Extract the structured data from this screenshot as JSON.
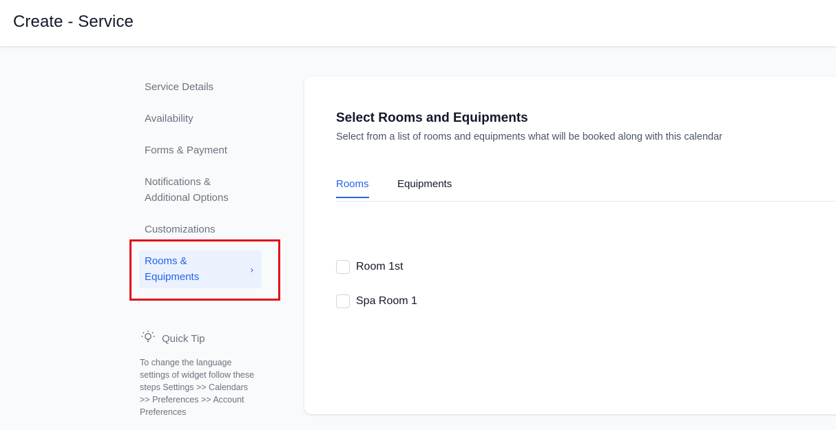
{
  "header": {
    "title": "Create - Service"
  },
  "sidebar": {
    "items": [
      {
        "label": "Service Details"
      },
      {
        "label": "Availability"
      },
      {
        "label": "Forms & Payment"
      },
      {
        "label_line1": "Notifications &",
        "label_line2": "Additional Options"
      },
      {
        "label": "Customizations"
      },
      {
        "label_line1": "Rooms &",
        "label_line2": "Equipments",
        "active": true,
        "chevron": "›"
      }
    ]
  },
  "quick_tip": {
    "title": "Quick Tip",
    "text": "To change the language settings of widget follow these steps Settings >> Calendars >> Preferences >> Account Preferences",
    "icon": "lightbulb-icon"
  },
  "main": {
    "title": "Select Rooms and Equipments",
    "subtitle": "Select from a list of rooms and equipments what will be booked along with this calendar",
    "tabs": [
      {
        "label": "Rooms",
        "active": true
      },
      {
        "label": "Equipments",
        "active": false
      }
    ],
    "rooms": [
      {
        "label": "Room 1st",
        "checked": false
      },
      {
        "label": "Spa Room 1",
        "checked": false
      }
    ]
  },
  "colors": {
    "accent": "#2563eb",
    "active_bg": "#ebf2fe",
    "highlight": "#e0111b",
    "muted_text": "#6b7280"
  }
}
